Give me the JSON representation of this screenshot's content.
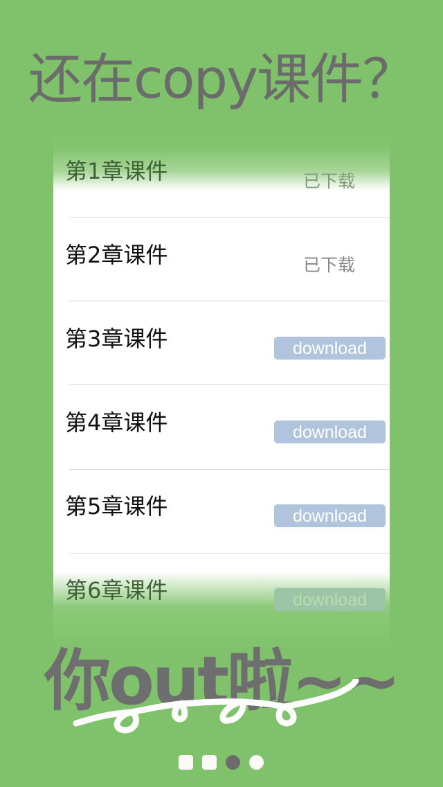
{
  "headline": "还在copy课件？",
  "courses": [
    {
      "name": "第1章课件",
      "status": "已下载"
    },
    {
      "name": "第2章课件",
      "status": "已下载"
    },
    {
      "name": "第3章课件",
      "action": "download"
    },
    {
      "name": "第4章课件",
      "action": "download"
    },
    {
      "name": "第5章课件",
      "action": "download"
    },
    {
      "name": "第6章课件",
      "action": "download"
    }
  ],
  "tagline": "你out啦~~",
  "pager": {
    "count": 4,
    "active_index": 2
  },
  "colors": {
    "background": "#7fc26b",
    "button": "#b0c4de",
    "text_gray": "#6b6b6b"
  }
}
